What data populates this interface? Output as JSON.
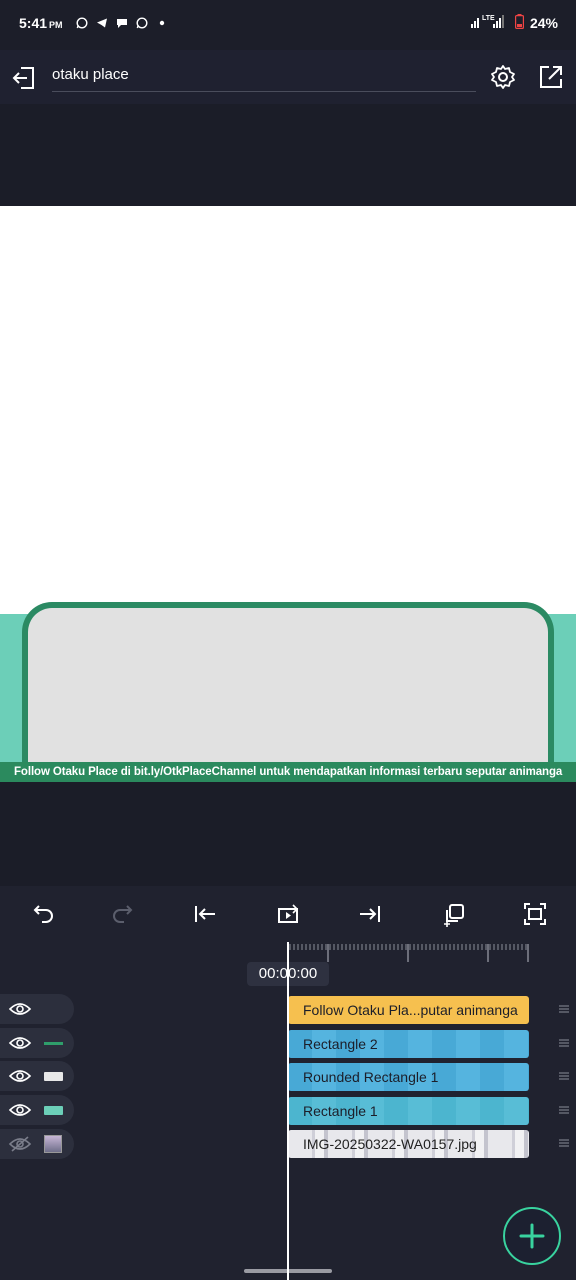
{
  "status": {
    "time": "5:41",
    "ampm": "PM",
    "network": "LTE",
    "battery": "24%"
  },
  "header": {
    "project_title": "otaku place"
  },
  "preview": {
    "ticker_text": "Follow Otaku Place di bit.ly/OtkPlaceChannel untuk mendapatkan informasi terbaru seputar animanga"
  },
  "timeline": {
    "current_time": "00:00:00",
    "layers": [
      {
        "name": "Follow Otaku Pla...putar animanga",
        "kind": "text",
        "swatch": "none",
        "visible": true
      },
      {
        "name": "Rectangle 2",
        "kind": "shape",
        "swatch": "#2f9e6b",
        "visible": true
      },
      {
        "name": "Rounded Rectangle 1",
        "kind": "shape",
        "swatch": "#e8e8e8",
        "visible": true
      },
      {
        "name": "Rectangle 1",
        "kind": "shape",
        "swatch": "#6ccfb8",
        "visible": true
      },
      {
        "name": "IMG-20250322-WA0157.jpg",
        "kind": "image",
        "swatch": "thumbnail",
        "visible": false
      }
    ]
  },
  "colors": {
    "accent": "#39d39f",
    "text_clip": "#f6c04f",
    "shape_clip": "#48a9d6"
  }
}
